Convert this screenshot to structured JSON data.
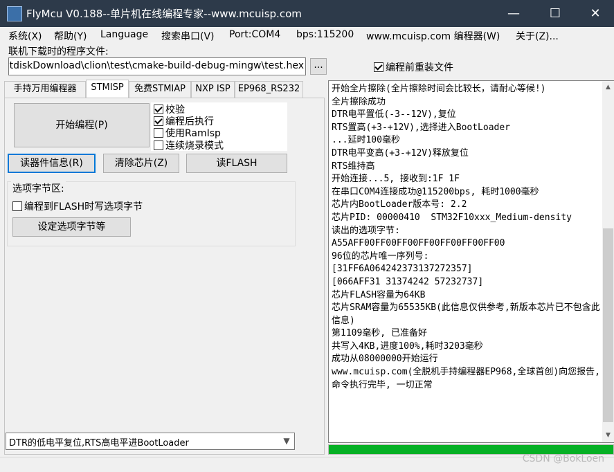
{
  "window": {
    "title": "FlyMcu V0.188--单片机在线编程专家--www.mcuisp.com",
    "minimize": "—",
    "maximize": "☐",
    "close": "✕"
  },
  "menu": [
    "系统(X)",
    "帮助(Y)",
    "Language",
    "搜索串口(V)",
    "Port:COM4",
    "bps:115200",
    "www.mcuisp.com 编程器(W)",
    "关于(Z)..."
  ],
  "file": {
    "label": "联机下载时的程序文件:",
    "path": "I:\\BaiduNetdiskDownload\\clion\\test\\cmake-build-debug-mingw\\test.hex",
    "browse": "...",
    "reload_label": "编程前重装文件",
    "reload_checked": true
  },
  "tabs": [
    "手持万用编程器",
    "STMISP",
    "免费STMIAP",
    "NXP ISP",
    "EP968_RS232"
  ],
  "active_tab": "STMISP",
  "actions": {
    "start": "开始编程(P)",
    "read_info": "读器件信息(R)",
    "erase": "清除芯片(Z)",
    "read_flash": "读FLASH"
  },
  "options": [
    {
      "label": "校验",
      "checked": true
    },
    {
      "label": "编程后执行",
      "checked": true
    },
    {
      "label": "使用RamIsp",
      "checked": false
    },
    {
      "label": "连续烧录模式",
      "checked": false
    }
  ],
  "option_bytes": {
    "group_label": "选项字节区:",
    "write_label": "编程到FLASH时写选项字节",
    "write_checked": false,
    "set_button": "设定选项字节等"
  },
  "reset_mode": {
    "selected": "DTR的低电平复位,RTS高电平进BootLoader",
    "arrow": "▼"
  },
  "log": "开始全片擦除(全片擦除时间会比较长，请耐心等候!)\n全片擦除成功\nDTR电平置低(-3--12V),复位\nRTS置高(+3-+12V),选择进入BootLoader\n...延时100毫秒\nDTR电平变高(+3-+12V)释放复位\nRTS维持高\n开始连接...5, 接收到:1F 1F\n在串口COM4连接成功@115200bps, 耗时1000毫秒\n芯片内BootLoader版本号: 2.2\n芯片PID: 00000410  STM32F10xxx_Medium-density\n读出的选项字节:\nA55AFF00FF00FF00FF00FF00FF00FF00\n96位的芯片唯一序列号:\n[31FF6A064242373137272357]\n[066AFF31 31374242 57232737]\n芯片FLASH容量为64KB\n芯片SRAM容量为65535KB(此信息仅供参考,新版本芯片已不包含此信息)\n第1109毫秒, 已准备好\n共写入4KB,进度100%,耗时3203毫秒\n成功从08000000开始运行\nwww.mcuisp.com(全脱机手持编程器EP968,全球首创)向您报告, 命令执行完毕, 一切正常",
  "progress": 1.0,
  "watermark": "CSDN @BokLoen",
  "colors": {
    "titlebar": "#2d3a4a",
    "progress": "#06b025",
    "focus": "#0078d7"
  }
}
